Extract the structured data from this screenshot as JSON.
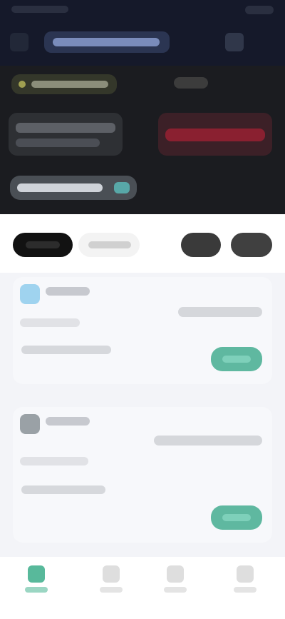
{
  "colors": {
    "header_bg": "#15192a",
    "hero_bg": "#1b1c20",
    "accent_green": "#5fb8a0",
    "danger_red": "#8a2030",
    "avatar_blue": "#9fd3ef"
  },
  "icons": {
    "header_left": "back-arrow-icon",
    "header_right": "menu-icon",
    "nav": [
      "home-icon",
      "markets-icon",
      "trade-icon",
      "account-icon"
    ]
  }
}
